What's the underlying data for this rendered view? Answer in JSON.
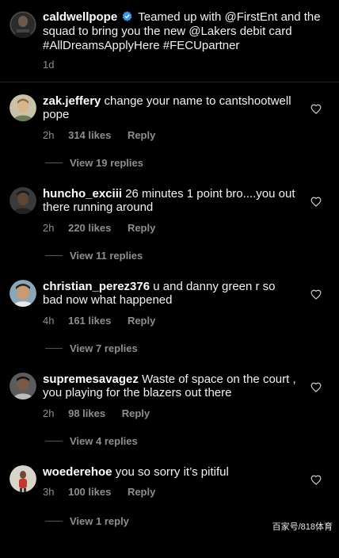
{
  "caption": {
    "username": "caldwellpope",
    "text": "Teamed up with @FirstEnt and the squad to bring you the new @Lakers debit card #AllDreamsApplyHere #FECUpartner",
    "time": "1d"
  },
  "comments": [
    {
      "username": "zak.jeffery",
      "text": "change your name to cantshootwell pope",
      "time": "2h",
      "likes": "314 likes",
      "reply": "Reply",
      "view_replies": "View 19 replies"
    },
    {
      "username": "huncho_exciii",
      "text": "26 minutes 1 point bro....you out there running around",
      "time": "2h",
      "likes": "220 likes",
      "reply": "Reply",
      "view_replies": "View 11 replies"
    },
    {
      "username": "christian_perez376",
      "text": "u and danny green r so bad now what happened",
      "time": "4h",
      "likes": "161 likes",
      "reply": "Reply",
      "view_replies": "View 7 replies"
    },
    {
      "username": "supremesavagez",
      "text": "Waste of space on the court , you playing for the blazers out there",
      "time": "2h",
      "likes": "98 likes",
      "reply": "Reply",
      "view_replies": "View 4 replies"
    },
    {
      "username": "woederehoe",
      "text": "you so sorry it’s pitiful",
      "time": "3h",
      "likes": "100 likes",
      "reply": "Reply",
      "view_replies": "View 1 reply"
    }
  ],
  "watermark": "百家号/818体育",
  "colors": {
    "background": "#000000",
    "text": "#f2f2f2",
    "muted": "#8e8e8e",
    "verified": "#3897f0"
  }
}
